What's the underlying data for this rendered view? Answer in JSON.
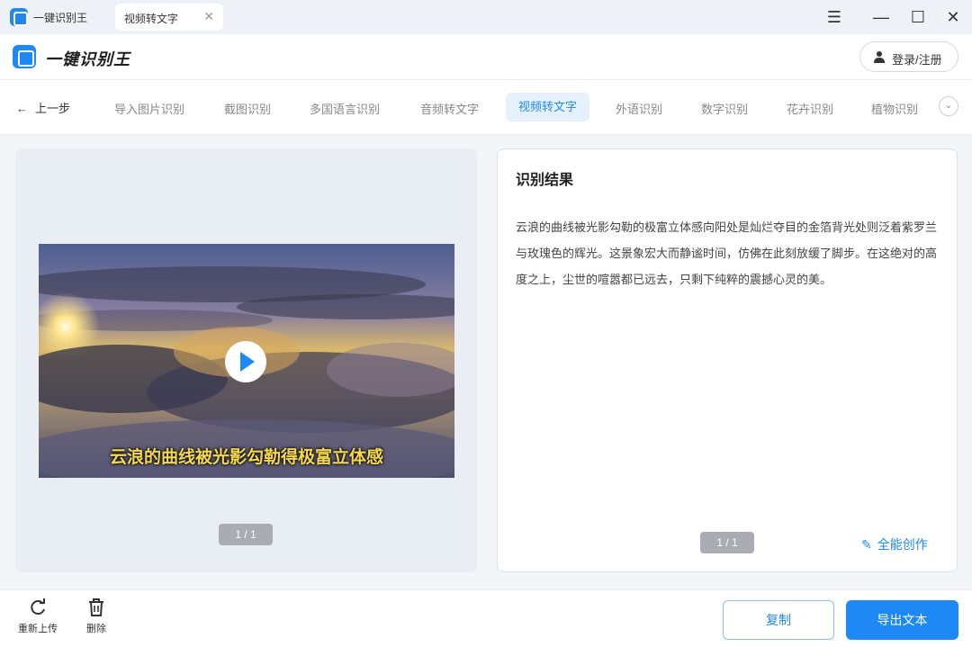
{
  "titlebar": {
    "app_name": "一键识别王",
    "tab_label": "视频转文字",
    "tab_close": "✕",
    "menu_icon": "☰",
    "minimize": "—",
    "maximize": "☐",
    "close": "✕"
  },
  "header": {
    "logo_text": "一键识别王",
    "login_label": "登录/注册"
  },
  "nav": {
    "back_label": "上一步",
    "items": [
      {
        "label": "导入图片识别"
      },
      {
        "label": "截图识别"
      },
      {
        "label": "多国语言识别"
      },
      {
        "label": "音频转文字"
      },
      {
        "label": "视频转文字"
      },
      {
        "label": "外语识别"
      },
      {
        "label": "数字识别"
      },
      {
        "label": "花卉识别"
      },
      {
        "label": "植物识别"
      }
    ],
    "more_icon": "⌄"
  },
  "left_panel": {
    "subtitle": "云浪的曲线被光影勾勒得极富立体感",
    "pager": "1 / 1"
  },
  "right_panel": {
    "title": "识别结果",
    "text": "云浪的曲线被光影勾勒的极富立体感向阳处是灿烂夺目的金箔背光处则泛着紫罗兰与玫瑰色的辉光。这景象宏大而静谧时间，仿佛在此刻放缓了脚步。在这绝对的高度之上，尘世的喧嚣都已远去，只剩下纯粹的震撼心灵的美。",
    "pager": "1 / 1",
    "create_label": "全能创作"
  },
  "footer": {
    "reupload_label": "重新上传",
    "delete_label": "删除",
    "copy_label": "复制",
    "export_label": "导出文本"
  },
  "colors": {
    "accent": "#1e88f5",
    "nav_active_bg": "#e6f1fe",
    "subtitle": "#f5d94a"
  }
}
